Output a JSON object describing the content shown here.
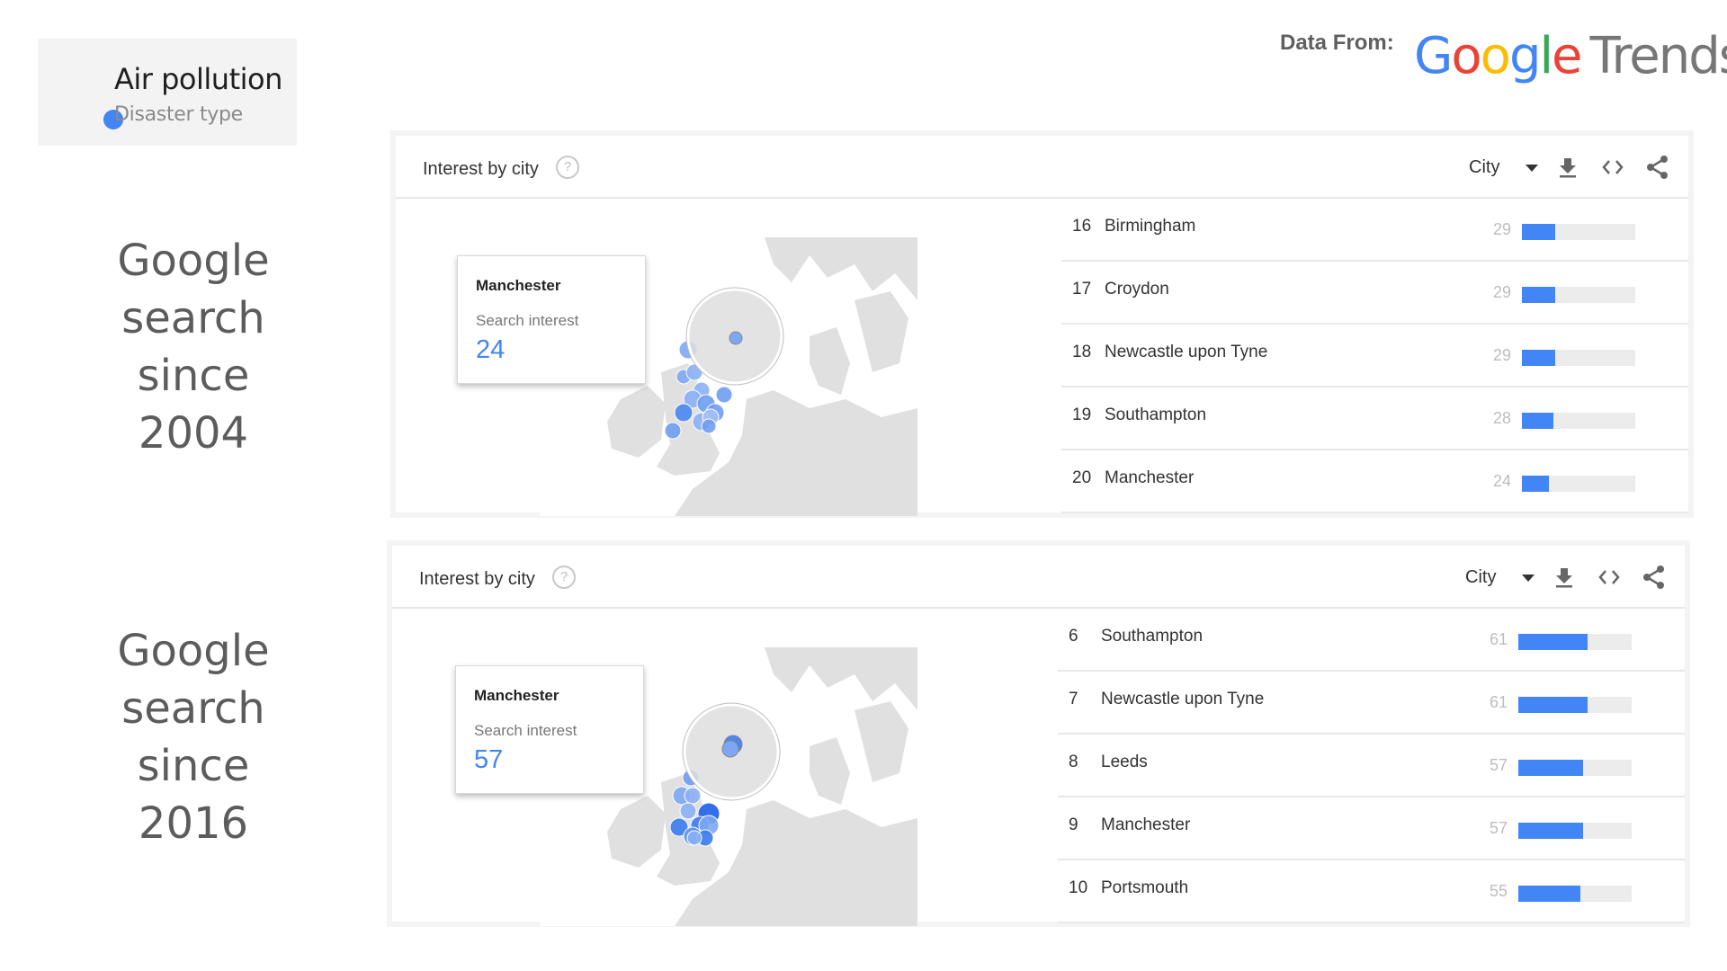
{
  "legend": {
    "title": "Air pollution",
    "subtitle": "Disaster type",
    "dot_color": "#4285f4"
  },
  "captions": [
    {
      "lines": [
        "Google",
        "search",
        "since",
        "2004"
      ]
    },
    {
      "lines": [
        "Google",
        "search",
        "since",
        "2016"
      ]
    }
  ],
  "attribution": {
    "label": "Data From:",
    "logo_letters": [
      {
        "char": "G",
        "color": "#4285f4"
      },
      {
        "char": "o",
        "color": "#ea4335"
      },
      {
        "char": "o",
        "color": "#fbbc05"
      },
      {
        "char": "g",
        "color": "#4285f4"
      },
      {
        "char": "l",
        "color": "#34a853"
      },
      {
        "char": "e",
        "color": "#ea4335"
      }
    ],
    "logo_suffix": "Trends"
  },
  "panels": [
    {
      "title": "Interest by city",
      "help_icon": "?",
      "granularity": "City",
      "icons": [
        "download-icon",
        "embed-icon",
        "share-icon"
      ],
      "tooltip": {
        "city": "Manchester",
        "label": "Search interest",
        "value": "24"
      },
      "rows": [
        {
          "rank": "16",
          "city": "Birmingham",
          "value": 29
        },
        {
          "rank": "17",
          "city": "Croydon",
          "value": 29
        },
        {
          "rank": "18",
          "city": "Newcastle upon Tyne",
          "value": 29
        },
        {
          "rank": "19",
          "city": "Southampton",
          "value": 28
        },
        {
          "rank": "20",
          "city": "Manchester",
          "value": 24
        }
      ]
    },
    {
      "title": "Interest by city",
      "help_icon": "?",
      "granularity": "City",
      "icons": [
        "download-icon",
        "embed-icon",
        "share-icon"
      ],
      "tooltip": {
        "city": "Manchester",
        "label": "Search interest",
        "value": "57"
      },
      "rows": [
        {
          "rank": "6",
          "city": "Southampton",
          "value": 61
        },
        {
          "rank": "7",
          "city": "Newcastle upon Tyne",
          "value": 61
        },
        {
          "rank": "8",
          "city": "Leeds",
          "value": 57
        },
        {
          "rank": "9",
          "city": "Manchester",
          "value": 57
        },
        {
          "rank": "10",
          "city": "Portsmouth",
          "value": 55
        }
      ]
    }
  ],
  "colors": {
    "accent": "#4285f4",
    "map_land": "#e0e0e0",
    "bar_track": "#ececec"
  }
}
